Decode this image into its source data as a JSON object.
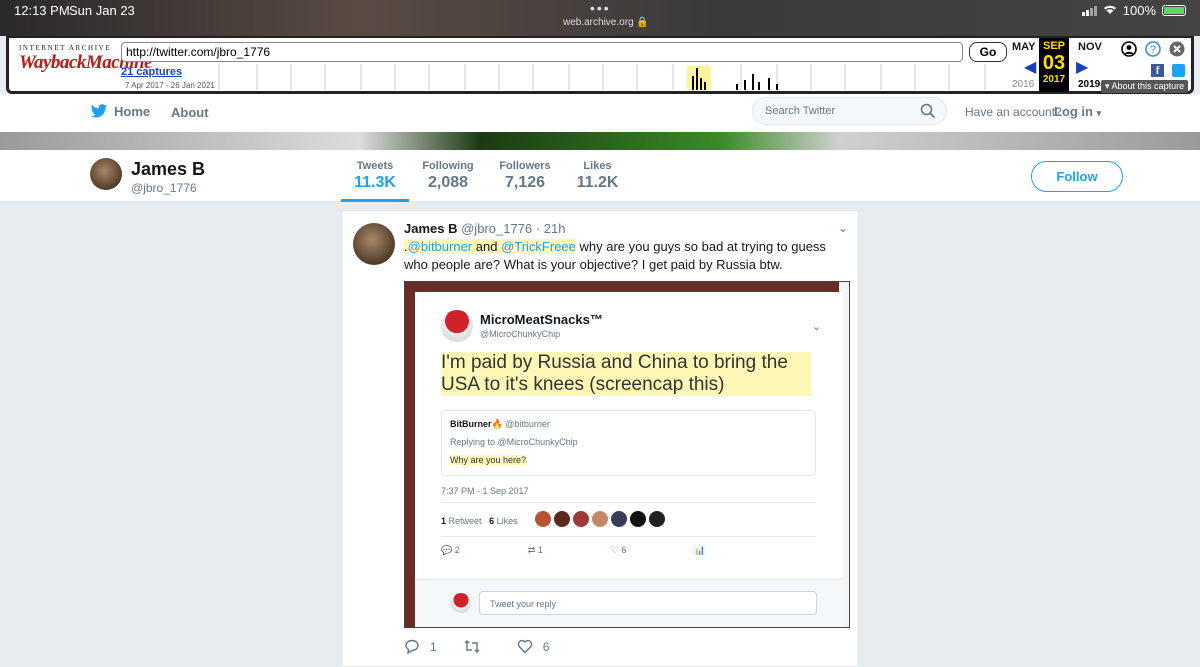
{
  "status": {
    "time": "12:13 PM",
    "date": "Sun Jan 23",
    "host": "web.archive.org",
    "battery": "100%"
  },
  "wayback": {
    "logo_top": "INTERNET ARCHIVE",
    "logo_main": "WaybackMachine",
    "url": "http://twitter.com/jbro_1776",
    "go": "Go",
    "captures": "21 captures",
    "range": "7 Apr 2017 - 26 Jan 2021",
    "prev_month": "MAY",
    "cur_month": "SEP",
    "next_month": "NOV",
    "prev_year": "2016",
    "cur_day": "03",
    "cur_year": "2017",
    "next_year": "2019",
    "about": "About this capture"
  },
  "nav": {
    "home": "Home",
    "about": "About",
    "search_placeholder": "Search Twitter",
    "have_account": "Have an account?",
    "login": "Log in"
  },
  "profile": {
    "name": "James B",
    "handle": "@jbro_1776",
    "stats": [
      {
        "label": "Tweets",
        "value": "11.3K"
      },
      {
        "label": "Following",
        "value": "2,088"
      },
      {
        "label": "Followers",
        "value": "7,126"
      },
      {
        "label": "Likes",
        "value": "11.2K"
      }
    ],
    "follow": "Follow"
  },
  "tweet": {
    "name": "James B",
    "handle": "@jbro_1776",
    "time": "21h",
    "prefix": ".",
    "mention1": "@bitburner",
    "and": " and ",
    "mention2": "@TrickFreee",
    "text": " why are you guys so bad at trying to guess who people are? What is your objective? I get paid by Russia btw.",
    "replies": "1",
    "retweets": "",
    "likes": "6"
  },
  "embedded": {
    "name": "MicroMeatSnacks™",
    "handle": "@MicroChunkyChip",
    "text": "I'm paid by Russia and China to bring the USA to it's knees (screencap this)",
    "quote_name": "BitBurner🔥",
    "quote_handle": "@bitburner",
    "quote_reply": "Replying to @MicroChunkyChip",
    "quote_text": "Why are you here?",
    "timestamp": "7:37 PM - 1 Sep 2017",
    "retweet_count": "1",
    "retweet_label": "Retweet",
    "likes_count": "6",
    "likes_label": "Likes",
    "replies": "2",
    "retweets": "1",
    "likes": "6",
    "reply_placeholder": "Tweet your reply"
  }
}
